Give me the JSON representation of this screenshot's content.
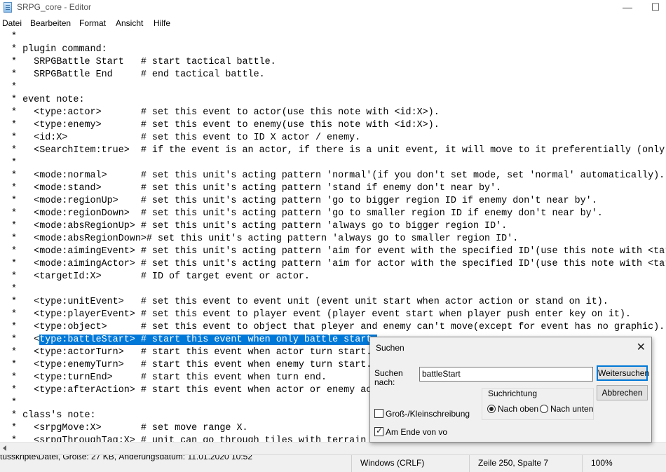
{
  "window": {
    "title": "SRPG_core - Editor",
    "minimize_glyph": "—",
    "maximize_glyph": "☐"
  },
  "menu": [
    "Datei",
    "Bearbeiten",
    "Format",
    "Ansicht",
    "Hilfe"
  ],
  "editor": {
    "lines": [
      " *",
      " * plugin command:",
      " *   SRPGBattle Start   # start tactical battle.",
      " *   SRPGBattle End     # end tactical battle.",
      " *",
      " * event note:",
      " *   <type:actor>       # set this event to actor(use this note with <id:X>).",
      " *   <type:enemy>       # set this event to enemy(use this note with <id:X>).",
      " *   <id:X>             # set this event to ID X actor / enemy.",
      " *   <SearchItem:true>  # if the event is an actor, if there is a unit event, it will move to it preferentially (only o",
      " *",
      " *   <mode:normal>      # set this unit's acting pattern 'normal'(if you don't set mode, set 'normal' automatically).",
      " *   <mode:stand>       # set this unit's acting pattern 'stand if enemy don't near by'.",
      " *   <mode:regionUp>    # set this unit's acting pattern 'go to bigger region ID if enemy don't near by'.",
      " *   <mode:regionDown>  # set this unit's acting pattern 'go to smaller region ID if enemy don't near by'.",
      " *   <mode:absRegionUp> # set this unit's acting pattern 'always go to bigger region ID'.",
      " *   <mode:absRegionDown># set this unit's acting pattern 'always go to smaller region ID'.",
      " *   <mode:aimingEvent> # set this unit's acting pattern 'aim for event with the specified ID'(use this note with <targ",
      " *   <mode:aimingActor> # set this unit's acting pattern 'aim for actor with the specified ID'(use this note with <targ",
      " *   <targetId:X>       # ID of target event or actor.",
      " *",
      " *   <type:unitEvent>   # set this event to event unit (event unit start when actor action or stand on it).",
      " *   <type:playerEvent> # set this event to player event (player event start when player push enter key on it).",
      " *   <type:object>      # set this event to object that pleyer and enemy can't move(except for event has no graphic).",
      " *   <type:battleStart> # start this event when only battle start.",
      " *   <type:actorTurn>   # start this event when actor turn start.",
      " *   <type:enemyTurn>   # start this event when enemy turn start.",
      " *   <type:turnEnd>     # start this event when turn end.",
      " *   <type:afterAction> # start this event when actor or enemy act",
      " *",
      " * class's note:",
      " *   <srpgMove:X>       # set move range X.",
      " *   <srpgThroughTag:X> # unit can go through tiles with terrain t"
    ],
    "selected_line": {
      "prefix": " *   <",
      "selected": "type:battleStart> # start this event when only battle start."
    }
  },
  "status": {
    "file_info": "tusskripte\\Datei, Größe: 27 KB, Änderungsdatum: 11.01.2020 10:52",
    "line_ending": "Windows (CRLF)",
    "position": "Zeile 250, Spalte 7",
    "zoom": "100%"
  },
  "find_dialog": {
    "title": "Suchen",
    "search_label_line1": "Suchen",
    "search_label_line2": "nach:",
    "search_value": "battleStart",
    "find_next_button": "Weitersuchen",
    "cancel_button": "Abbrechen",
    "direction_group": "Suchrichtung",
    "direction_up": "Nach oben",
    "direction_down": "Nach unten",
    "direction_selected": "up",
    "match_case_label": "Groß-/Kleinschreibung",
    "match_case_checked": false,
    "wrap_label": "Am Ende von vo",
    "wrap_checked": true,
    "close_glyph": "✕"
  },
  "colors": {
    "selection": "#0078d7",
    "focus_border": "#0078d7"
  }
}
